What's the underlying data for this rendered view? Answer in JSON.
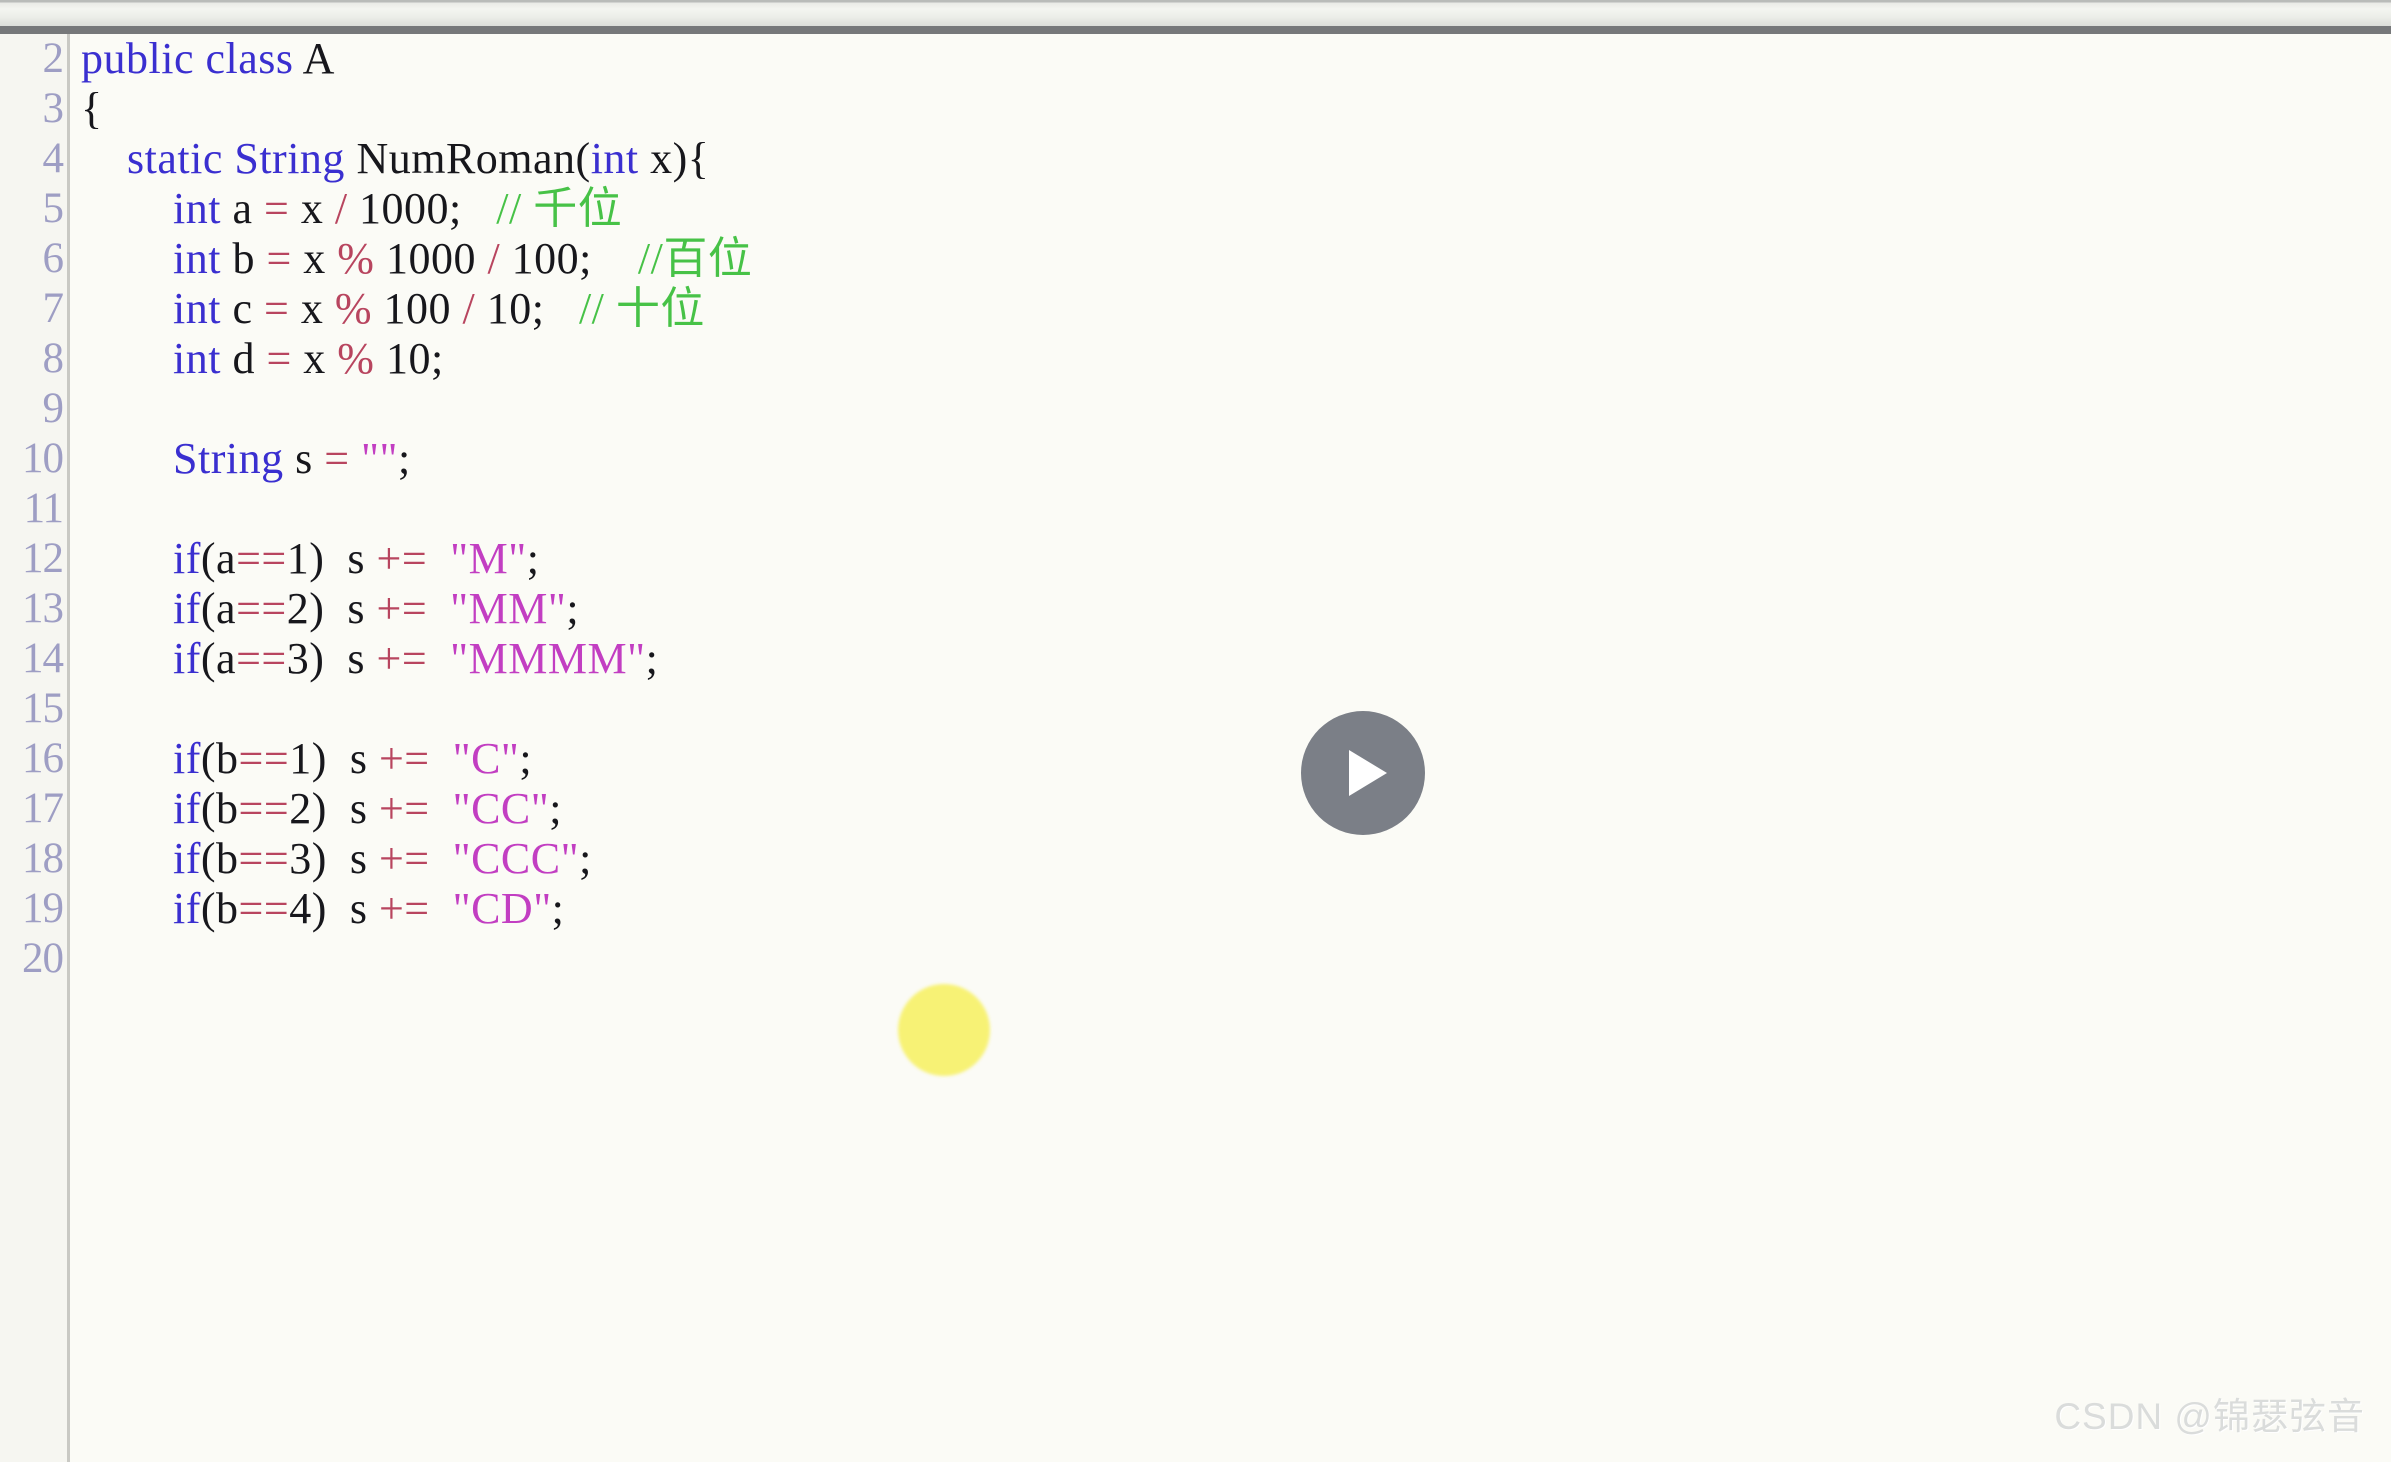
{
  "window": {
    "kind": "video-player-with-code-editor-frame",
    "toolbar_visible": true
  },
  "editor": {
    "language": "Java",
    "first_visible_line": 2,
    "last_visible_line": 20,
    "line_numbers": [
      "2",
      "3",
      "4",
      "5",
      "6",
      "7",
      "8",
      "9",
      "10",
      "11",
      "12",
      "13",
      "14",
      "15",
      "16",
      "17",
      "18",
      "19",
      "20"
    ],
    "lines": [
      {
        "number": "2",
        "tokens": [
          {
            "t": "public",
            "c": "kw"
          },
          {
            "t": " ",
            "c": "punct"
          },
          {
            "t": "class",
            "c": "kw"
          },
          {
            "t": " ",
            "c": "punct"
          },
          {
            "t": "A",
            "c": "ident"
          }
        ]
      },
      {
        "number": "3",
        "tokens": [
          {
            "t": "{",
            "c": "punct"
          }
        ]
      },
      {
        "number": "4",
        "tokens": [
          {
            "t": "    ",
            "c": "punct"
          },
          {
            "t": "static",
            "c": "kw"
          },
          {
            "t": " ",
            "c": "punct"
          },
          {
            "t": "String",
            "c": "kw"
          },
          {
            "t": " ",
            "c": "punct"
          },
          {
            "t": "NumRoman",
            "c": "ident"
          },
          {
            "t": "(",
            "c": "punct"
          },
          {
            "t": "int",
            "c": "kw"
          },
          {
            "t": " ",
            "c": "punct"
          },
          {
            "t": "x",
            "c": "ident"
          },
          {
            "t": "){",
            "c": "punct"
          }
        ]
      },
      {
        "number": "5",
        "tokens": [
          {
            "t": "        ",
            "c": "punct"
          },
          {
            "t": "int",
            "c": "kw"
          },
          {
            "t": " ",
            "c": "punct"
          },
          {
            "t": "a",
            "c": "ident"
          },
          {
            "t": " ",
            "c": "punct"
          },
          {
            "t": "=",
            "c": "op"
          },
          {
            "t": " ",
            "c": "punct"
          },
          {
            "t": "x",
            "c": "ident"
          },
          {
            "t": " ",
            "c": "punct"
          },
          {
            "t": "/",
            "c": "op"
          },
          {
            "t": " ",
            "c": "punct"
          },
          {
            "t": "1000",
            "c": "num"
          },
          {
            "t": ";",
            "c": "punct"
          },
          {
            "t": "   ",
            "c": "punct"
          },
          {
            "t": "// 千位",
            "c": "cmt"
          }
        ]
      },
      {
        "number": "6",
        "tokens": [
          {
            "t": "        ",
            "c": "punct"
          },
          {
            "t": "int",
            "c": "kw"
          },
          {
            "t": " ",
            "c": "punct"
          },
          {
            "t": "b",
            "c": "ident"
          },
          {
            "t": " ",
            "c": "punct"
          },
          {
            "t": "=",
            "c": "op"
          },
          {
            "t": " ",
            "c": "punct"
          },
          {
            "t": "x",
            "c": "ident"
          },
          {
            "t": " ",
            "c": "punct"
          },
          {
            "t": "%",
            "c": "op"
          },
          {
            "t": " ",
            "c": "punct"
          },
          {
            "t": "1000",
            "c": "num"
          },
          {
            "t": " ",
            "c": "punct"
          },
          {
            "t": "/",
            "c": "op"
          },
          {
            "t": " ",
            "c": "punct"
          },
          {
            "t": "100",
            "c": "num"
          },
          {
            "t": ";",
            "c": "punct"
          },
          {
            "t": "    ",
            "c": "punct"
          },
          {
            "t": "//百位",
            "c": "cmt"
          }
        ]
      },
      {
        "number": "7",
        "tokens": [
          {
            "t": "        ",
            "c": "punct"
          },
          {
            "t": "int",
            "c": "kw"
          },
          {
            "t": " ",
            "c": "punct"
          },
          {
            "t": "c",
            "c": "ident"
          },
          {
            "t": " ",
            "c": "punct"
          },
          {
            "t": "=",
            "c": "op"
          },
          {
            "t": " ",
            "c": "punct"
          },
          {
            "t": "x",
            "c": "ident"
          },
          {
            "t": " ",
            "c": "punct"
          },
          {
            "t": "%",
            "c": "op"
          },
          {
            "t": " ",
            "c": "punct"
          },
          {
            "t": "100",
            "c": "num"
          },
          {
            "t": " ",
            "c": "punct"
          },
          {
            "t": "/",
            "c": "op"
          },
          {
            "t": " ",
            "c": "punct"
          },
          {
            "t": "10",
            "c": "num"
          },
          {
            "t": ";",
            "c": "punct"
          },
          {
            "t": "   ",
            "c": "punct"
          },
          {
            "t": "// 十位",
            "c": "cmt"
          }
        ]
      },
      {
        "number": "8",
        "tokens": [
          {
            "t": "        ",
            "c": "punct"
          },
          {
            "t": "int",
            "c": "kw"
          },
          {
            "t": " ",
            "c": "punct"
          },
          {
            "t": "d",
            "c": "ident"
          },
          {
            "t": " ",
            "c": "punct"
          },
          {
            "t": "=",
            "c": "op"
          },
          {
            "t": " ",
            "c": "punct"
          },
          {
            "t": "x",
            "c": "ident"
          },
          {
            "t": " ",
            "c": "punct"
          },
          {
            "t": "%",
            "c": "op"
          },
          {
            "t": " ",
            "c": "punct"
          },
          {
            "t": "10",
            "c": "num"
          },
          {
            "t": ";",
            "c": "punct"
          }
        ]
      },
      {
        "number": "9",
        "tokens": []
      },
      {
        "number": "10",
        "tokens": [
          {
            "t": "        ",
            "c": "punct"
          },
          {
            "t": "String",
            "c": "kw"
          },
          {
            "t": " ",
            "c": "punct"
          },
          {
            "t": "s",
            "c": "ident"
          },
          {
            "t": " ",
            "c": "punct"
          },
          {
            "t": "=",
            "c": "op"
          },
          {
            "t": " ",
            "c": "punct"
          },
          {
            "t": "\"\"",
            "c": "str"
          },
          {
            "t": ";",
            "c": "punct"
          }
        ]
      },
      {
        "number": "11",
        "tokens": []
      },
      {
        "number": "12",
        "tokens": [
          {
            "t": "        ",
            "c": "punct"
          },
          {
            "t": "if",
            "c": "kw"
          },
          {
            "t": "(",
            "c": "punct"
          },
          {
            "t": "a",
            "c": "ident"
          },
          {
            "t": "==",
            "c": "op"
          },
          {
            "t": "1",
            "c": "num"
          },
          {
            "t": ")",
            "c": "punct"
          },
          {
            "t": "  ",
            "c": "punct"
          },
          {
            "t": "s",
            "c": "ident"
          },
          {
            "t": " ",
            "c": "punct"
          },
          {
            "t": "+=",
            "c": "op"
          },
          {
            "t": "  ",
            "c": "punct"
          },
          {
            "t": "\"M\"",
            "c": "str"
          },
          {
            "t": ";",
            "c": "punct"
          }
        ]
      },
      {
        "number": "13",
        "tokens": [
          {
            "t": "        ",
            "c": "punct"
          },
          {
            "t": "if",
            "c": "kw"
          },
          {
            "t": "(",
            "c": "punct"
          },
          {
            "t": "a",
            "c": "ident"
          },
          {
            "t": "==",
            "c": "op"
          },
          {
            "t": "2",
            "c": "num"
          },
          {
            "t": ")",
            "c": "punct"
          },
          {
            "t": "  ",
            "c": "punct"
          },
          {
            "t": "s",
            "c": "ident"
          },
          {
            "t": " ",
            "c": "punct"
          },
          {
            "t": "+=",
            "c": "op"
          },
          {
            "t": "  ",
            "c": "punct"
          },
          {
            "t": "\"MM\"",
            "c": "str"
          },
          {
            "t": ";",
            "c": "punct"
          }
        ]
      },
      {
        "number": "14",
        "tokens": [
          {
            "t": "        ",
            "c": "punct"
          },
          {
            "t": "if",
            "c": "kw"
          },
          {
            "t": "(",
            "c": "punct"
          },
          {
            "t": "a",
            "c": "ident"
          },
          {
            "t": "==",
            "c": "op"
          },
          {
            "t": "3",
            "c": "num"
          },
          {
            "t": ")",
            "c": "punct"
          },
          {
            "t": "  ",
            "c": "punct"
          },
          {
            "t": "s",
            "c": "ident"
          },
          {
            "t": " ",
            "c": "punct"
          },
          {
            "t": "+=",
            "c": "op"
          },
          {
            "t": "  ",
            "c": "punct"
          },
          {
            "t": "\"MMMM\"",
            "c": "str"
          },
          {
            "t": ";",
            "c": "punct"
          }
        ]
      },
      {
        "number": "15",
        "tokens": []
      },
      {
        "number": "16",
        "tokens": [
          {
            "t": "        ",
            "c": "punct"
          },
          {
            "t": "if",
            "c": "kw"
          },
          {
            "t": "(",
            "c": "punct"
          },
          {
            "t": "b",
            "c": "ident"
          },
          {
            "t": "==",
            "c": "op"
          },
          {
            "t": "1",
            "c": "num"
          },
          {
            "t": ")",
            "c": "punct"
          },
          {
            "t": "  ",
            "c": "punct"
          },
          {
            "t": "s",
            "c": "ident"
          },
          {
            "t": " ",
            "c": "punct"
          },
          {
            "t": "+=",
            "c": "op"
          },
          {
            "t": "  ",
            "c": "punct"
          },
          {
            "t": "\"C\"",
            "c": "str"
          },
          {
            "t": ";",
            "c": "punct"
          }
        ]
      },
      {
        "number": "17",
        "tokens": [
          {
            "t": "        ",
            "c": "punct"
          },
          {
            "t": "if",
            "c": "kw"
          },
          {
            "t": "(",
            "c": "punct"
          },
          {
            "t": "b",
            "c": "ident"
          },
          {
            "t": "==",
            "c": "op"
          },
          {
            "t": "2",
            "c": "num"
          },
          {
            "t": ")",
            "c": "punct"
          },
          {
            "t": "  ",
            "c": "punct"
          },
          {
            "t": "s",
            "c": "ident"
          },
          {
            "t": " ",
            "c": "punct"
          },
          {
            "t": "+=",
            "c": "op"
          },
          {
            "t": "  ",
            "c": "punct"
          },
          {
            "t": "\"CC\"",
            "c": "str"
          },
          {
            "t": ";",
            "c": "punct"
          }
        ]
      },
      {
        "number": "18",
        "tokens": [
          {
            "t": "        ",
            "c": "punct"
          },
          {
            "t": "if",
            "c": "kw"
          },
          {
            "t": "(",
            "c": "punct"
          },
          {
            "t": "b",
            "c": "ident"
          },
          {
            "t": "==",
            "c": "op"
          },
          {
            "t": "3",
            "c": "num"
          },
          {
            "t": ")",
            "c": "punct"
          },
          {
            "t": "  ",
            "c": "punct"
          },
          {
            "t": "s",
            "c": "ident"
          },
          {
            "t": " ",
            "c": "punct"
          },
          {
            "t": "+=",
            "c": "op"
          },
          {
            "t": "  ",
            "c": "punct"
          },
          {
            "t": "\"CCC\"",
            "c": "str"
          },
          {
            "t": ";",
            "c": "punct"
          }
        ]
      },
      {
        "number": "19",
        "tokens": [
          {
            "t": "        ",
            "c": "punct"
          },
          {
            "t": "if",
            "c": "kw"
          },
          {
            "t": "(",
            "c": "punct"
          },
          {
            "t": "b",
            "c": "ident"
          },
          {
            "t": "==",
            "c": "op"
          },
          {
            "t": "4",
            "c": "num"
          },
          {
            "t": ")",
            "c": "punct"
          },
          {
            "t": "  ",
            "c": "punct"
          },
          {
            "t": "s",
            "c": "ident"
          },
          {
            "t": " ",
            "c": "punct"
          },
          {
            "t": "+=",
            "c": "op"
          },
          {
            "t": "  ",
            "c": "punct"
          },
          {
            "t": "\"CD\"",
            "c": "str"
          },
          {
            "t": ";",
            "c": "punct"
          }
        ]
      },
      {
        "number": "20",
        "tokens": []
      }
    ]
  },
  "overlay": {
    "play_button_label": "▶",
    "cursor_highlight_visible": true
  },
  "watermark": {
    "text": "CSDN @锦瑟弦音"
  },
  "colors": {
    "keyword": "#3a2fd0",
    "string": "#c23ec2",
    "comment": "#47c247",
    "operator": "#b8455f",
    "identifier": "#17171c",
    "gutter_number": "#9e9ec4",
    "editor_background": "#fbfbf6",
    "highlight_blob": "#f7f164",
    "play_button": "#7b7f87",
    "watermark": "#dadcdb"
  }
}
